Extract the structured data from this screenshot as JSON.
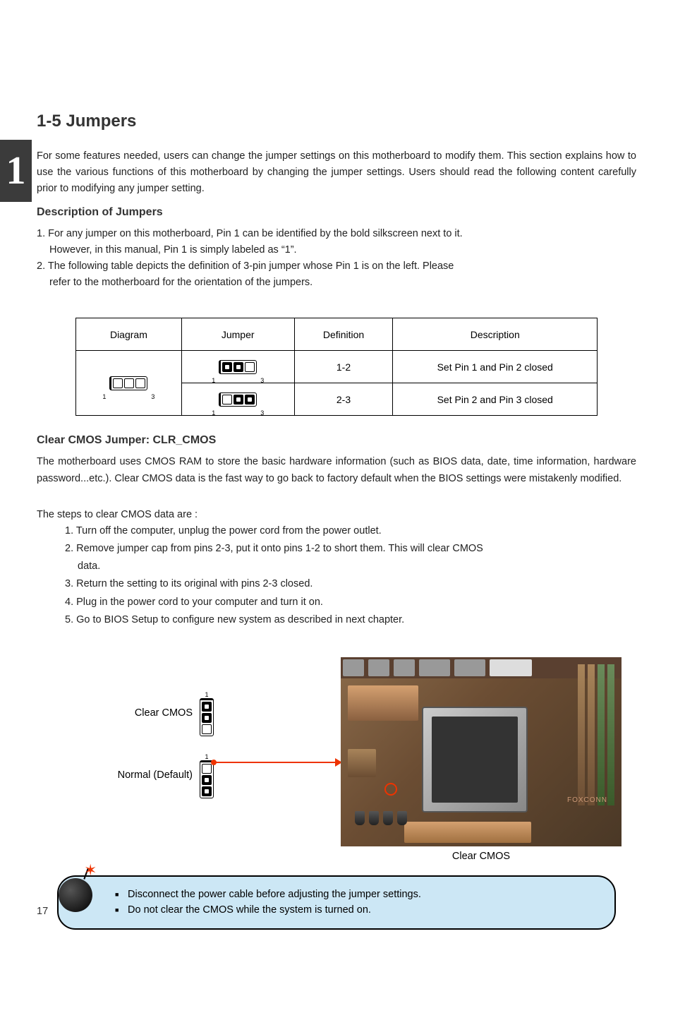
{
  "sideTab": "1",
  "sectionTitle": "1-5 Jumpers",
  "introParagraph1": "For some features needed, users can change the jumper settings on this motherboard to modify them. This section explains how to use the various functions of this motherboard by changing the jumper settings. Users should read the following content carefully prior to modifying any jumper setting.",
  "descHeading": "Description of Jumpers",
  "desc1": "1. For any jumper on this motherboard, Pin 1 can be identified by the bold silkscreen next to it.",
  "desc1b": "However, in this manual, Pin 1 is simply labeled as “1”.",
  "desc2": "2. The following table depicts the definition of 3-pin jumper whose Pin 1 is on the left. Please",
  "desc2b": "refer to the motherboard for the orientation of the jumpers.",
  "table": {
    "headers": {
      "dia": "Diagram",
      "jumper": "Jumper",
      "def": "Definition",
      "desc": "Description"
    },
    "row1": {
      "def": "1-2",
      "desc": "Set Pin 1 and Pin 2 closed"
    },
    "row2": {
      "def": "2-3",
      "desc": "Set Pin 2 and Pin 3 closed"
    },
    "pinLabel1": "1",
    "pinLabel3": "3"
  },
  "clearCmos": {
    "heading": "Clear CMOS Jumper: CLR_CMOS",
    "para1": "The motherboard uses CMOS RAM to store the basic hardware information (such as BIOS data, date, time information, hardware password...etc.). Clear CMOS data is the fast way to go back to factory default when the BIOS settings were mistakenly modified.",
    "stepsIntro": "The steps to clear CMOS data are :",
    "step1": "1. Turn off the computer, unplug the power cord from the power outlet.",
    "step2": "2. Remove jumper cap from pins 2-3, put it onto pins 1-2 to short them. This will clear CMOS",
    "step2b": "data.",
    "step3": "3. Return the setting to its original with pins 2-3 closed.",
    "step4": "4. Plug in the power cord to your computer and turn it on.",
    "step5": "5. Go to BIOS Setup to configure new system as described in next chapter."
  },
  "figure": {
    "label1": "Clear CMOS",
    "label2": "Normal (Default)",
    "clrLabel": "Clear CMOS",
    "pin1": "1"
  },
  "notes": {
    "n1": "Disconnect the power cable before adjusting the jumper settings.",
    "n2": "Do not clear the CMOS while the system is turned on."
  },
  "footer": "17"
}
